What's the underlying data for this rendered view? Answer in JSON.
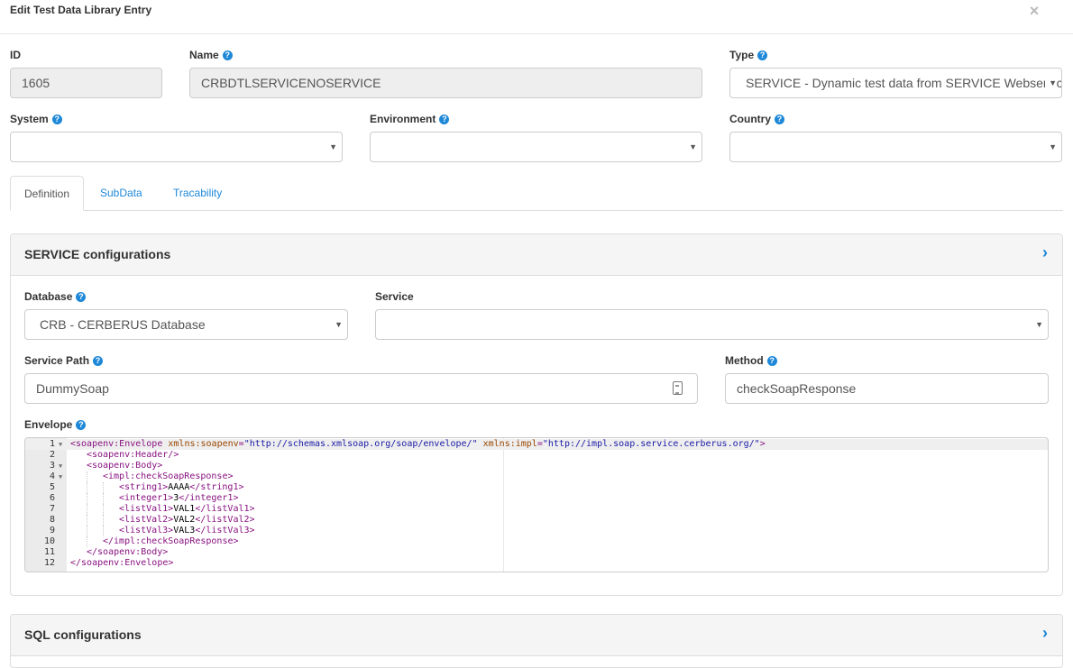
{
  "modal": {
    "title": "Edit Test Data Library Entry",
    "close_icon": "×"
  },
  "form": {
    "id": {
      "label": "ID",
      "value": "1605"
    },
    "name": {
      "label": "Name",
      "value": "CRBDTLSERVICENOSERVICE"
    },
    "type": {
      "label": "Type",
      "value": "SERVICE - Dynamic test data from SERVICE Webservice"
    },
    "system": {
      "label": "System",
      "value": ""
    },
    "environment": {
      "label": "Environment",
      "value": ""
    },
    "country": {
      "label": "Country",
      "value": ""
    }
  },
  "help_icon": "?",
  "caret_icon": "▼",
  "tabs": [
    {
      "label": "Definition",
      "active": true
    },
    {
      "label": "SubData",
      "active": false
    },
    {
      "label": "Tracability",
      "active": false
    }
  ],
  "service_panel": {
    "title": "SERVICE configurations",
    "chevron_icon": "›",
    "database": {
      "label": "Database",
      "value": "CRB - CERBERUS Database"
    },
    "service": {
      "label": "Service",
      "value": ""
    },
    "service_path": {
      "label": "Service Path",
      "value": "DummySoap"
    },
    "method": {
      "label": "Method",
      "value": "checkSoapResponse"
    },
    "envelope": {
      "label": "Envelope",
      "lines": [
        {
          "n": "1",
          "fold": true,
          "indent": 0,
          "tokens": [
            [
              "t-tag",
              "<soapenv:Envelope"
            ],
            [
              "t-text",
              " "
            ],
            [
              "t-attr",
              "xmlns:soapenv"
            ],
            [
              "t-punc",
              "="
            ],
            [
              "t-val",
              "\"http://schemas.xmlsoap.org/soap/envelope/\""
            ],
            [
              "t-text",
              " "
            ],
            [
              "t-attr",
              "xmlns:impl"
            ],
            [
              "t-punc",
              "="
            ],
            [
              "t-val",
              "\"http://impl.soap.service.cerberus.org/\""
            ],
            [
              "t-tag",
              ">"
            ]
          ]
        },
        {
          "n": "2",
          "fold": false,
          "indent": 1,
          "tokens": [
            [
              "t-tag",
              "<soapenv:Header/>"
            ]
          ]
        },
        {
          "n": "3",
          "fold": true,
          "indent": 1,
          "tokens": [
            [
              "t-tag",
              "<soapenv:Body>"
            ]
          ]
        },
        {
          "n": "4",
          "fold": true,
          "indent": 2,
          "tokens": [
            [
              "t-tag",
              "<impl:checkSoapResponse>"
            ]
          ]
        },
        {
          "n": "5",
          "fold": false,
          "indent": 3,
          "tokens": [
            [
              "t-tag",
              "<string1>"
            ],
            [
              "t-text",
              "AAAA"
            ],
            [
              "t-tag",
              "</string1>"
            ]
          ]
        },
        {
          "n": "6",
          "fold": false,
          "indent": 3,
          "tokens": [
            [
              "t-tag",
              "<integer1>"
            ],
            [
              "t-text",
              "3"
            ],
            [
              "t-tag",
              "</integer1>"
            ]
          ]
        },
        {
          "n": "7",
          "fold": false,
          "indent": 3,
          "tokens": [
            [
              "t-tag",
              "<listVal1>"
            ],
            [
              "t-text",
              "VAL1"
            ],
            [
              "t-tag",
              "</listVal1>"
            ]
          ]
        },
        {
          "n": "8",
          "fold": false,
          "indent": 3,
          "tokens": [
            [
              "t-tag",
              "<listVal2>"
            ],
            [
              "t-text",
              "VAL2"
            ],
            [
              "t-tag",
              "</listVal2>"
            ]
          ]
        },
        {
          "n": "9",
          "fold": false,
          "indent": 3,
          "tokens": [
            [
              "t-tag",
              "<listVal3>"
            ],
            [
              "t-text",
              "VAL3"
            ],
            [
              "t-tag",
              "</listVal3>"
            ]
          ]
        },
        {
          "n": "10",
          "fold": false,
          "indent": 2,
          "tokens": [
            [
              "t-tag",
              "</impl:checkSoapResponse>"
            ]
          ]
        },
        {
          "n": "11",
          "fold": false,
          "indent": 1,
          "tokens": [
            [
              "t-tag",
              "</soapenv:Body>"
            ]
          ]
        },
        {
          "n": "12",
          "fold": false,
          "indent": 0,
          "tokens": [
            [
              "t-tag",
              "</soapenv:Envelope>"
            ]
          ]
        }
      ]
    }
  },
  "sql_panel": {
    "title": "SQL configurations",
    "chevron_icon": "›"
  }
}
